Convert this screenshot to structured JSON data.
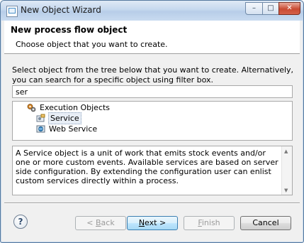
{
  "window": {
    "title": "New Object Wizard",
    "minimize_glyph": "–",
    "maximize_glyph": "□",
    "close_glyph": "✕"
  },
  "header": {
    "title": "New process flow object",
    "subtitle": "Choose object that you want to create."
  },
  "instructions": "Select object from the tree below that you want to create. Alternatively, you can search for a specific object using filter box.",
  "filter": {
    "value": "ser"
  },
  "tree": {
    "root": {
      "label": "Execution Objects",
      "icon": "gears-icon"
    },
    "children": [
      {
        "label": "Service",
        "icon": "service-icon",
        "selected": true
      },
      {
        "label": "Web Service",
        "icon": "web-service-icon",
        "selected": false
      }
    ]
  },
  "description": "A Service object is a unit of work that emits stock events and/or one or more custom events. Available services are based on server side configuration. By extending the configuration user can enlist custom services directly within a process.",
  "buttons": {
    "help": "?",
    "back": {
      "prefix": "< ",
      "mnemonic": "B",
      "rest": "ack"
    },
    "next": {
      "mnemonic": "N",
      "rest": "ext >"
    },
    "finish": {
      "mnemonic": "F",
      "rest": "inish"
    },
    "cancel": "Cancel"
  },
  "colors": {
    "title_bar": "#c5d8ee",
    "close_button": "#c94a32",
    "default_button": "#bee6fd"
  }
}
